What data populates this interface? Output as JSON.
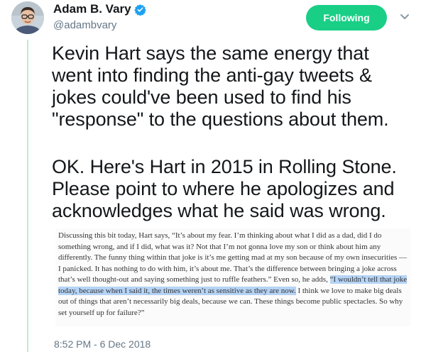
{
  "author": {
    "name": "Adam B. Vary",
    "handle": "@adambvary"
  },
  "follow_button": {
    "label": "Following"
  },
  "tweet": {
    "paragraph1": "Kevin Hart says the same energy that\nwent into finding the anti-gay tweets &\njokes could've been used to find his\n\"response\" to the questions about them.",
    "paragraph2": "OK. Here's Hart in 2015 in Rolling Stone.\nPlease point to where he apologizes and\nacknowledges what he said was wrong."
  },
  "quote": {
    "text_before": "Discussing this bit today, Hart says, “It’s about my fear. I’m thinking about what I did as a dad, did I do something wrong, and if I did, what was it? Not that I’m not gonna love my son or think about him any differently. The funny thing within that joke is it’s me getting mad at my son because of my own insecurities — I panicked. It has nothing to do with him, it’s about me. That’s the difference between bringing a joke across that’s well thought-out and saying something just to ruffle feathers.” Even so, he adds, ",
    "highlighted": "“I wouldn’t tell that joke today, because when I said it, the times weren’t as sensitive as they are now.",
    "text_after": " I think we love to make big deals out of things that aren’t necessarily big deals, because we can. These things become public spectacles. So why set yourself up for failure?”"
  },
  "timestamp": "8:52 PM - 6 Dec 2018",
  "colors": {
    "follow_button": "#19cf86",
    "thread_line": "#b7f0c4",
    "highlight": "#b5d3f5",
    "verified_badge": "#1da1f2"
  },
  "icons": {
    "verified": "verified-badge-icon",
    "menu": "chevron-down-icon"
  }
}
